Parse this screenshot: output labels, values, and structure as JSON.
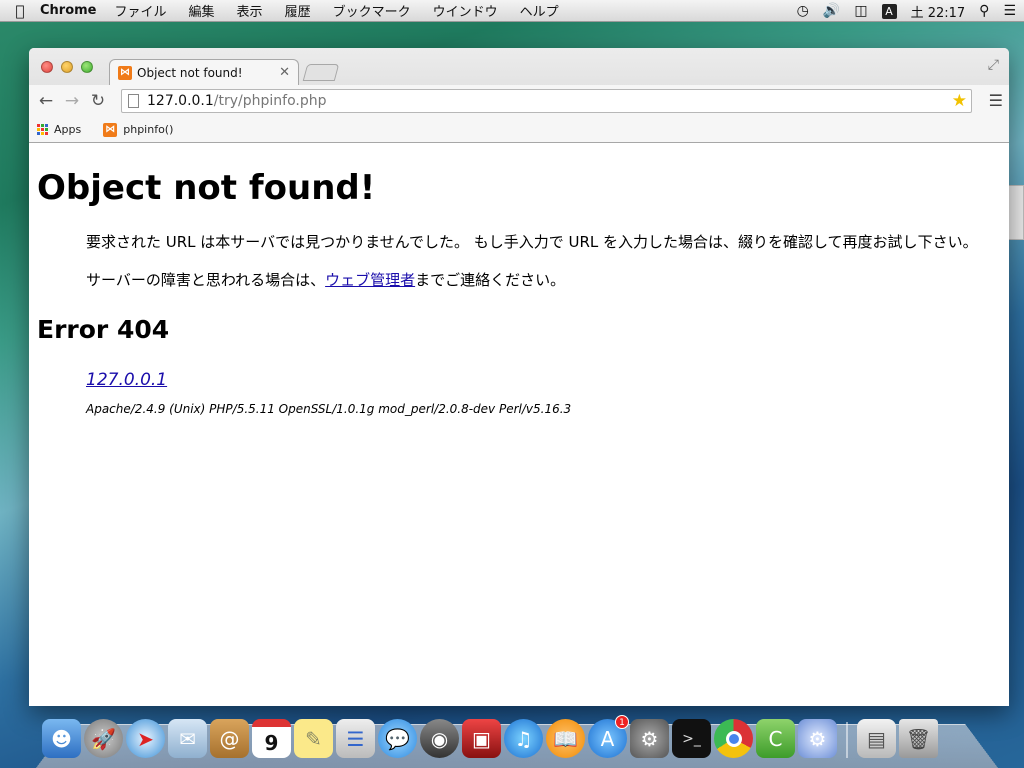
{
  "menubar": {
    "app_name": "Chrome",
    "items": [
      "ファイル",
      "編集",
      "表示",
      "履歴",
      "ブックマーク",
      "ウインドウ",
      "ヘルプ"
    ],
    "input_indicator": "A",
    "clock": "土 22:17"
  },
  "browser": {
    "tab_title": "Object not found!",
    "url_host": "127.0.0.1",
    "url_path": "/try/phpinfo.php",
    "bookmarks": [
      {
        "label": "Apps",
        "icon": "apps-grid-icon"
      },
      {
        "label": "phpinfo()",
        "icon": "xampp-icon"
      }
    ]
  },
  "page": {
    "heading": "Object not found!",
    "para1": "要求された URL は本サーバでは見つかりませんでした。 もし手入力で URL を入力した場合は、綴りを確認して再度お試し下さい。",
    "para2_before": "サーバーの障害と思われる場合は、",
    "para2_link": "ウェブ管理者",
    "para2_after": "までご連絡ください。",
    "error_heading": "Error 404",
    "host_link": "127.0.0.1",
    "server_signature": "Apache/2.4.9 (Unix) PHP/5.5.11 OpenSSL/1.0.1g mod_perl/2.0.8-dev Perl/v5.16.3"
  },
  "dock": {
    "calendar_day": "9",
    "app_store_badge": "1"
  },
  "colors": {
    "link": "#1a0dab",
    "xampp_orange": "#f07b19",
    "star": "#f2c200"
  }
}
